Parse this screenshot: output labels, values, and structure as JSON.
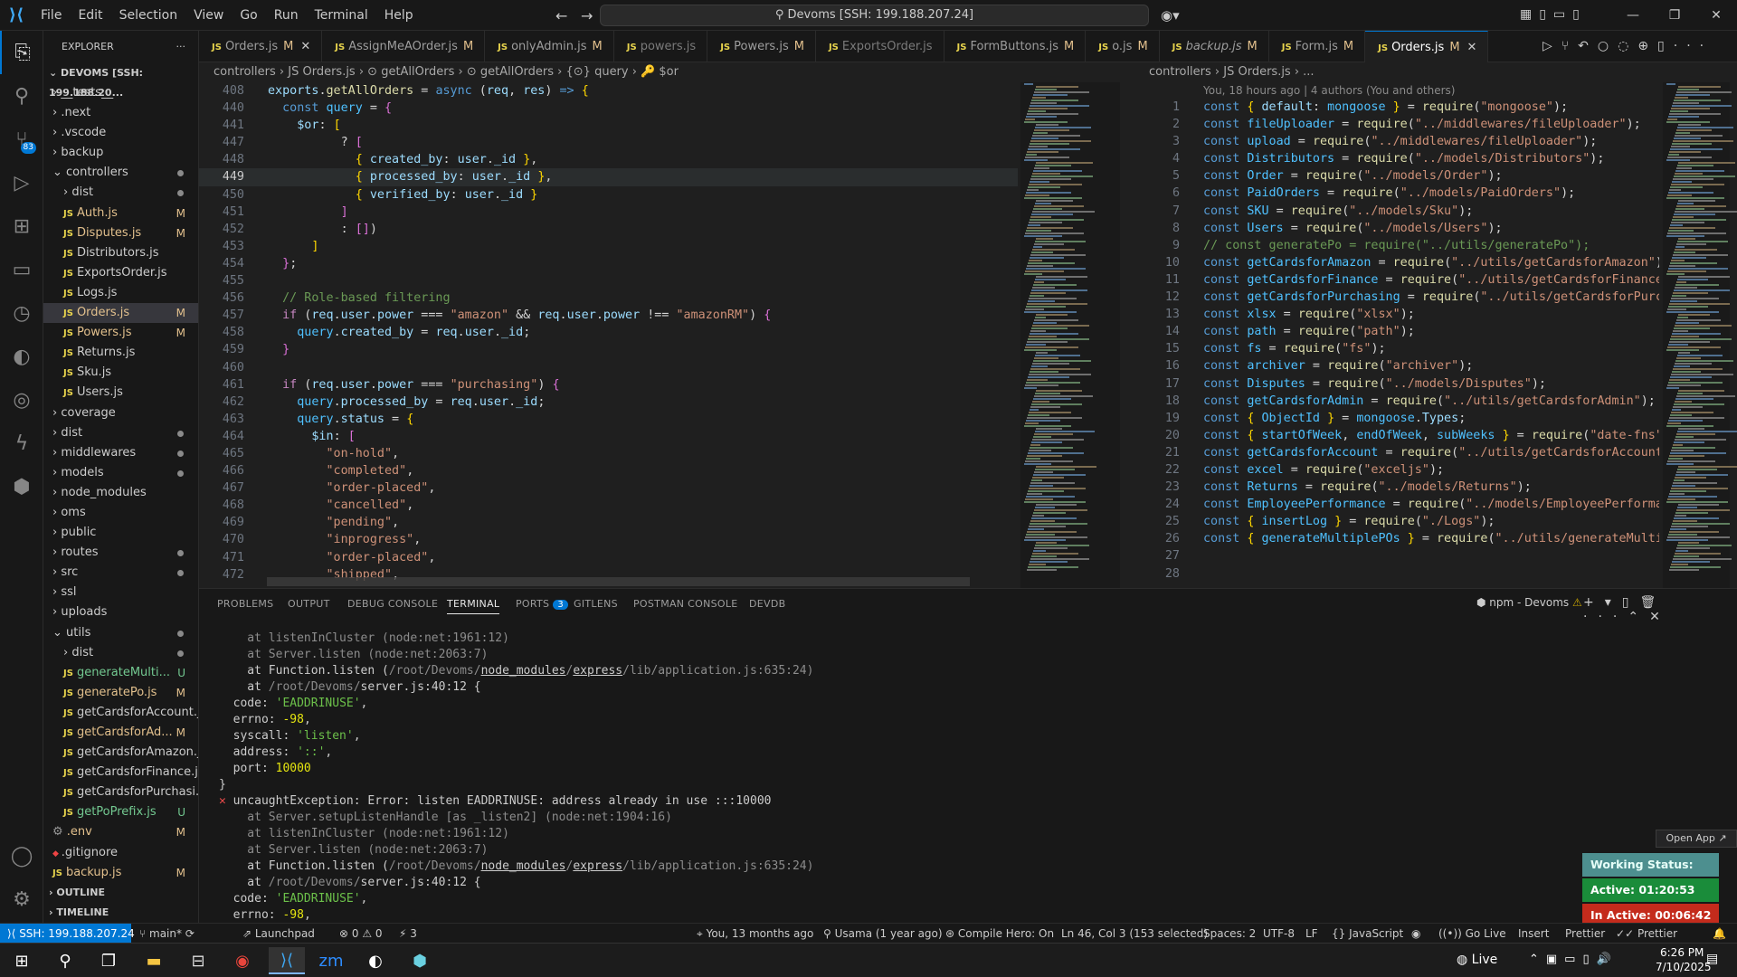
{
  "titlebar": {
    "menus": [
      "File",
      "Edit",
      "Selection",
      "View",
      "Go",
      "Run",
      "Terminal",
      "Help"
    ],
    "search": "Devoms [SSH: 199.188.207.24]"
  },
  "activity": {
    "source_control_badge": "83"
  },
  "explorer": {
    "title": "EXPLORER",
    "root": "DEVOMS [SSH: 199.188.20...",
    "items": [
      {
        "t": "f",
        "d": 1,
        "n": "__tests__",
        "s": ""
      },
      {
        "t": "f",
        "d": 1,
        "n": ".next",
        "s": ""
      },
      {
        "t": "f",
        "d": 1,
        "n": ".vscode",
        "s": ""
      },
      {
        "t": "f",
        "d": 1,
        "n": "backup",
        "s": ""
      },
      {
        "t": "o",
        "d": 1,
        "n": "controllers",
        "s": "dot"
      },
      {
        "t": "f",
        "d": 2,
        "n": "dist",
        "s": "dot"
      },
      {
        "t": "j",
        "d": 2,
        "n": "Auth.js",
        "s": "M"
      },
      {
        "t": "j",
        "d": 2,
        "n": "Disputes.js",
        "s": "M"
      },
      {
        "t": "j",
        "d": 2,
        "n": "Distributors.js",
        "s": ""
      },
      {
        "t": "j",
        "d": 2,
        "n": "ExportsOrder.js",
        "s": ""
      },
      {
        "t": "j",
        "d": 2,
        "n": "Logs.js",
        "s": ""
      },
      {
        "t": "j",
        "d": 2,
        "n": "Orders.js",
        "s": "M",
        "sel": true
      },
      {
        "t": "j",
        "d": 2,
        "n": "Powers.js",
        "s": "M"
      },
      {
        "t": "j",
        "d": 2,
        "n": "Returns.js",
        "s": ""
      },
      {
        "t": "j",
        "d": 2,
        "n": "Sku.js",
        "s": ""
      },
      {
        "t": "j",
        "d": 2,
        "n": "Users.js",
        "s": ""
      },
      {
        "t": "f",
        "d": 1,
        "n": "coverage",
        "s": ""
      },
      {
        "t": "f",
        "d": 1,
        "n": "dist",
        "s": "dot"
      },
      {
        "t": "f",
        "d": 1,
        "n": "middlewares",
        "s": "dot"
      },
      {
        "t": "f",
        "d": 1,
        "n": "models",
        "s": "dot"
      },
      {
        "t": "f",
        "d": 1,
        "n": "node_modules",
        "s": ""
      },
      {
        "t": "f",
        "d": 1,
        "n": "oms",
        "s": ""
      },
      {
        "t": "f",
        "d": 1,
        "n": "public",
        "s": ""
      },
      {
        "t": "f",
        "d": 1,
        "n": "routes",
        "s": "dot"
      },
      {
        "t": "f",
        "d": 1,
        "n": "src",
        "s": "dot"
      },
      {
        "t": "f",
        "d": 1,
        "n": "ssl",
        "s": ""
      },
      {
        "t": "f",
        "d": 1,
        "n": "uploads",
        "s": ""
      },
      {
        "t": "o",
        "d": 1,
        "n": "utils",
        "s": "dot"
      },
      {
        "t": "f",
        "d": 2,
        "n": "dist",
        "s": "dot"
      },
      {
        "t": "j",
        "d": 2,
        "n": "generateMulti...",
        "s": "U"
      },
      {
        "t": "j",
        "d": 2,
        "n": "generatePo.js",
        "s": "M"
      },
      {
        "t": "j",
        "d": 2,
        "n": "getCardsforAccount.js",
        "s": ""
      },
      {
        "t": "j",
        "d": 2,
        "n": "getCardsforAd...",
        "s": "M"
      },
      {
        "t": "j",
        "d": 2,
        "n": "getCardsforAmazon.js",
        "s": ""
      },
      {
        "t": "j",
        "d": 2,
        "n": "getCardsforFinance.js",
        "s": ""
      },
      {
        "t": "j",
        "d": 2,
        "n": "getCardsforPurchasi...",
        "s": ""
      },
      {
        "t": "j",
        "d": 2,
        "n": "getPoPrefix.js",
        "s": "U"
      },
      {
        "t": "e",
        "d": 1,
        "n": ".env",
        "s": "M"
      },
      {
        "t": "g",
        "d": 1,
        "n": ".gitignore",
        "s": ""
      },
      {
        "t": "j",
        "d": 1,
        "n": "backup.js",
        "s": "M"
      }
    ],
    "outline": "OUTLINE",
    "timeline": "TIMELINE"
  },
  "tabs": [
    {
      "n": "Orders.js",
      "m": "M",
      "x": true
    },
    {
      "n": "AssignMeAOrder.js",
      "m": "M"
    },
    {
      "n": "onlyAdmin.js",
      "m": "M"
    },
    {
      "n": "powers.js",
      "m": "",
      "dim": true
    },
    {
      "n": "Powers.js",
      "m": "M"
    },
    {
      "n": "ExportsOrder.js",
      "m": "",
      "dim": true
    },
    {
      "n": "FormButtons.js",
      "m": "M"
    },
    {
      "n": "o.js",
      "m": "M"
    },
    {
      "n": "backup.js",
      "m": "M",
      "ital": true
    },
    {
      "n": "Form.js",
      "m": "M"
    },
    {
      "n": "Orders.js",
      "m": "M",
      "x": true,
      "active": true
    }
  ],
  "left_crumbs": "controllers  ›  JS Orders.js  ›  ⊙ getAllOrders  ›  ⊙ getAllOrders  ›  {⊙} query  ›  🔑 $or",
  "right_crumbs": "controllers  ›  JS Orders.js  ›  ...",
  "right_blame": "You, 18 hours ago | 4 authors (You and others)",
  "left_lines": [
    {
      "n": "408",
      "h": "<span class='v'>exports</span>.<span class='f'>getAllOrders</span> = <span class='k'>async</span> (<span class='v'>req</span>, <span class='v'>res</span>) <span class='k'>=&gt;</span> <span class='y'>{</span>"
    },
    {
      "n": "440",
      "h": "  <span class='k'>const</span> <span class='n'>query</span> = <span class='p'>{</span>"
    },
    {
      "n": "441",
      "h": "    <span class='v'>$or</span>: <span class='y'>[</span>"
    },
    {
      "n": "447",
      "h": "          ? <span class='p'>[</span>"
    },
    {
      "n": "448",
      "h": "            <span class='y'>{</span> <span class='v'>created_by</span>: <span class='v'>user</span>.<span class='v'>_id</span> <span class='y'>}</span>,"
    },
    {
      "n": "449",
      "h": "            <span class='y'>{</span> <span class='v'>processed_by</span>: <span class='v'>user</span>.<span class='v'>_id</span> <span class='y'>}</span>,",
      "cur": true
    },
    {
      "n": "450",
      "h": "            <span class='y'>{</span> <span class='v'>verified_by</span>: <span class='v'>user</span>.<span class='v'>_id</span> <span class='y'>}</span>"
    },
    {
      "n": "451",
      "h": "          <span class='p'>]</span>"
    },
    {
      "n": "452",
      "h": "          : <span class='p'>[]</span>)"
    },
    {
      "n": "453",
      "h": "      <span class='y'>]</span>"
    },
    {
      "n": "454",
      "h": "  <span class='p'>}</span>;"
    },
    {
      "n": "455",
      "h": ""
    },
    {
      "n": "456",
      "h": "  <span class='c'>// Role-based filtering</span>"
    },
    {
      "n": "457",
      "h": "  <span class='kc'>if</span> (<span class='v'>req</span>.<span class='v'>user</span>.<span class='v'>power</span> === <span class='s'>\"amazon\"</span> &amp;&amp; <span class='v'>req</span>.<span class='v'>user</span>.<span class='v'>power</span> !== <span class='s'>\"amazonRM\"</span>) <span class='p'>{</span>"
    },
    {
      "n": "458",
      "h": "    <span class='n'>query</span>.<span class='v'>created_by</span> = <span class='v'>req</span>.<span class='v'>user</span>.<span class='v'>_id</span>;"
    },
    {
      "n": "459",
      "h": "  <span class='p'>}</span>"
    },
    {
      "n": "460",
      "h": ""
    },
    {
      "n": "461",
      "h": "  <span class='kc'>if</span> (<span class='v'>req</span>.<span class='v'>user</span>.<span class='v'>power</span> === <span class='s'>\"purchasing\"</span>) <span class='p'>{</span>"
    },
    {
      "n": "462",
      "h": "    <span class='n'>query</span>.<span class='v'>processed_by</span> = <span class='v'>req</span>.<span class='v'>user</span>.<span class='v'>_id</span>;"
    },
    {
      "n": "463",
      "h": "    <span class='n'>query</span>.<span class='v'>status</span> = <span class='y'>{</span>"
    },
    {
      "n": "464",
      "h": "      <span class='v'>$in</span>: <span class='p'>[</span>"
    },
    {
      "n": "465",
      "h": "        <span class='s'>\"on-hold\"</span>,"
    },
    {
      "n": "466",
      "h": "        <span class='s'>\"completed\"</span>,"
    },
    {
      "n": "467",
      "h": "        <span class='s'>\"order-placed\"</span>,"
    },
    {
      "n": "468",
      "h": "        <span class='s'>\"cancelled\"</span>,"
    },
    {
      "n": "469",
      "h": "        <span class='s'>\"pending\"</span>,"
    },
    {
      "n": "470",
      "h": "        <span class='s'>\"inprogress\"</span>,"
    },
    {
      "n": "471",
      "h": "        <span class='s'>\"order-placed\"</span>,"
    },
    {
      "n": "472",
      "h": "        <span class='s'>\"shipped\"</span>,"
    }
  ],
  "right_lines": [
    {
      "n": "1",
      "h": "<span class='k'>const</span> <span class='y'>{</span> <span class='v'>default</span>: <span class='n'>mongoose</span> <span class='y'>}</span> = <span class='f'>require</span>(<span class='s'>\"mongoose\"</span>);"
    },
    {
      "n": "2",
      "h": "<span class='k'>const</span> <span class='n'>fileUploader</span> = <span class='f'>require</span>(<span class='s'>\"../middlewares/fileUploader\"</span>);"
    },
    {
      "n": "3",
      "h": "<span class='k'>const</span> <span class='n'>upload</span> = <span class='f'>require</span>(<span class='s'>\"../middlewares/fileUploader\"</span>);"
    },
    {
      "n": "4",
      "h": "<span class='k'>const</span> <span class='n'>Distributors</span> = <span class='f'>require</span>(<span class='s'>\"../models/Distributors\"</span>);"
    },
    {
      "n": "5",
      "h": "<span class='k'>const</span> <span class='n'>Order</span> = <span class='f'>require</span>(<span class='s'>\"../models/Order\"</span>);"
    },
    {
      "n": "6",
      "h": "<span class='k'>const</span> <span class='n'>PaidOrders</span> = <span class='f'>require</span>(<span class='s'>\"../models/PaidOrders\"</span>);"
    },
    {
      "n": "7",
      "h": "<span class='k'>const</span> <span class='n'>SKU</span> = <span class='f'>require</span>(<span class='s'>\"../models/Sku\"</span>);"
    },
    {
      "n": "8",
      "h": "<span class='k'>const</span> <span class='n'>Users</span> = <span class='f'>require</span>(<span class='s'>\"../models/Users\"</span>);"
    },
    {
      "n": "9",
      "h": "<span class='c'>// const generatePo = require(\"../utils/generatePo\");</span>"
    },
    {
      "n": "10",
      "h": "<span class='k'>const</span> <span class='n'>getCardsforAmazon</span> = <span class='f'>require</span>(<span class='s'>\"../utils/getCardsforAmazon\"</span>);"
    },
    {
      "n": "11",
      "h": "<span class='k'>const</span> <span class='n'>getCardsforFinance</span> = <span class='f'>require</span>(<span class='s'>\"../utils/getCardsforFinance\"</span>)"
    },
    {
      "n": "12",
      "h": "<span class='k'>const</span> <span class='n'>getCardsforPurchasing</span> = <span class='f'>require</span>(<span class='s'>\"../utils/getCardsforPurcha</span>"
    },
    {
      "n": "13",
      "h": "<span class='k'>const</span> <span class='n'>xlsx</span> = <span class='f'>require</span>(<span class='s'>\"xlsx\"</span>);"
    },
    {
      "n": "14",
      "h": "<span class='k'>const</span> <span class='n'>path</span> = <span class='f'>require</span>(<span class='s'>\"path\"</span>);"
    },
    {
      "n": "15",
      "h": "<span class='k'>const</span> <span class='n'>fs</span> = <span class='f'>require</span>(<span class='s'>\"fs\"</span>);"
    },
    {
      "n": "16",
      "h": "<span class='k'>const</span> <span class='n'>archiver</span> = <span class='f'>require</span>(<span class='s'>\"archiver\"</span>);"
    },
    {
      "n": "17",
      "h": "<span class='k'>const</span> <span class='n'>Disputes</span> = <span class='f'>require</span>(<span class='s'>\"../models/Disputes\"</span>);"
    },
    {
      "n": "18",
      "h": "<span class='k'>const</span> <span class='n'>getCardsforAdmin</span> = <span class='f'>require</span>(<span class='s'>\"../utils/getCardsforAdmin\"</span>);"
    },
    {
      "n": "19",
      "h": "<span class='k'>const</span> <span class='y'>{</span> <span class='n'>ObjectId</span> <span class='y'>}</span> = <span class='n'>mongoose</span>.<span class='v'>Types</span>;"
    },
    {
      "n": "20",
      "h": "<span class='k'>const</span> <span class='y'>{</span> <span class='n'>startOfWeek</span>, <span class='n'>endOfWeek</span>, <span class='n'>subWeeks</span> <span class='y'>}</span> = <span class='f'>require</span>(<span class='s'>\"date-fns\"</span>);"
    },
    {
      "n": "21",
      "h": "<span class='k'>const</span> <span class='n'>getCardsforAccount</span> = <span class='f'>require</span>(<span class='s'>\"../utils/getCardsforAccount\"</span>)"
    },
    {
      "n": "22",
      "h": "<span class='k'>const</span> <span class='n'>excel</span> = <span class='f'>require</span>(<span class='s'>\"exceljs\"</span>);"
    },
    {
      "n": "23",
      "h": "<span class='k'>const</span> <span class='n'>Returns</span> = <span class='f'>require</span>(<span class='s'>\"../models/Returns\"</span>);"
    },
    {
      "n": "24",
      "h": "<span class='k'>const</span> <span class='n'>EmployeePerformance</span> = <span class='f'>require</span>(<span class='s'>\"../models/EmployeePerformanc</span>"
    },
    {
      "n": "25",
      "h": "<span class='k'>const</span> <span class='y'>{</span> <span class='n'>insertLog</span> <span class='y'>}</span> = <span class='f'>require</span>(<span class='s'>\"./Logs\"</span>);"
    },
    {
      "n": "26",
      "h": "<span class='k'>const</span> <span class='y'>{</span> <span class='n'>generateMultiplePOs</span> <span class='y'>}</span> = <span class='f'>require</span>(<span class='s'>\"../utils/generateMultipl</span>"
    },
    {
      "n": "27",
      "h": ""
    },
    {
      "n": "28",
      "h": ""
    }
  ],
  "panel": {
    "tabs": [
      "PROBLEMS",
      "OUTPUT",
      "DEBUG CONSOLE",
      "TERMINAL",
      "PORTS",
      "GITLENS",
      "POSTMAN CONSOLE",
      "DEVDB"
    ],
    "ports_badge": "3",
    "terminal_name": "npm - Devoms",
    "lines": [
      "<span class='g'>    at listenInCluster (node:net:1961:12)</span>",
      "<span class='g'>    at Server.listen (node:net:2063:7)</span>",
      "    at Function.listen (<span class='g'>/root/Devoms/</span><span class='u'>node_modules</span><span class='g'>/</span><span class='u'>express</span><span class='g'>/lib/application.js:635:24)</span>",
      "    at <span class='g'>/root/Devoms/</span>server.js:40:12 {",
      "  code: <span class='str'>'EADDRINUSE'</span>,",
      "  errno: <span class='num'>-98</span>,",
      "  syscall: <span class='str'>'listen'</span>,",
      "  address: <span class='str'>'::'</span>,",
      "  port: <span class='num'>10000</span>",
      "}",
      "<span class='red'>✕</span> uncaughtException: Error: listen EADDRINUSE: address already in use :::10000",
      "<span class='g'>    at Server.setupListenHandle [as _listen2] (node:net:1904:16)</span>",
      "<span class='g'>    at listenInCluster (node:net:1961:12)</span>",
      "<span class='g'>    at Server.listen (node:net:2063:7)</span>",
      "    at Function.listen (<span class='g'>/root/Devoms/</span><span class='u'>node_modules</span><span class='g'>/</span><span class='u'>express</span><span class='g'>/lib/application.js:635:24)</span>",
      "    at <span class='g'>/root/Devoms/</span>server.js:40:12 {",
      "  code: <span class='str'>'EADDRINUSE'</span>,",
      "  errno: <span class='num'>-98</span>,"
    ],
    "open_app": "Open App ↗",
    "working_status": "Working Status: Active",
    "active_time": "Active: 01:20:53",
    "inactive_time": "In Active: 00:06:42"
  },
  "status": {
    "remote": "SSH: 199.188.207.24",
    "branch": "main*",
    "launchpad": "Launchpad",
    "problems": "⊗ 0 ⚠ 0",
    "ports": "⚡ 3",
    "blame": "You, 13 months ago",
    "author": "Usama (1 year ago)",
    "compile": "Compile Hero: On",
    "pos": "Ln 46, Col 3 (153 selected)",
    "spaces": "Spaces: 2",
    "enc": "UTF-8",
    "eol": "LF",
    "lang": "JavaScript",
    "golive": "Go Live",
    "insert": "Insert",
    "prettier1": "Prettier",
    "prettier2": "Prettier"
  },
  "taskbar": {
    "live": "Live",
    "time": "6:26 PM",
    "date": "7/10/2025"
  }
}
